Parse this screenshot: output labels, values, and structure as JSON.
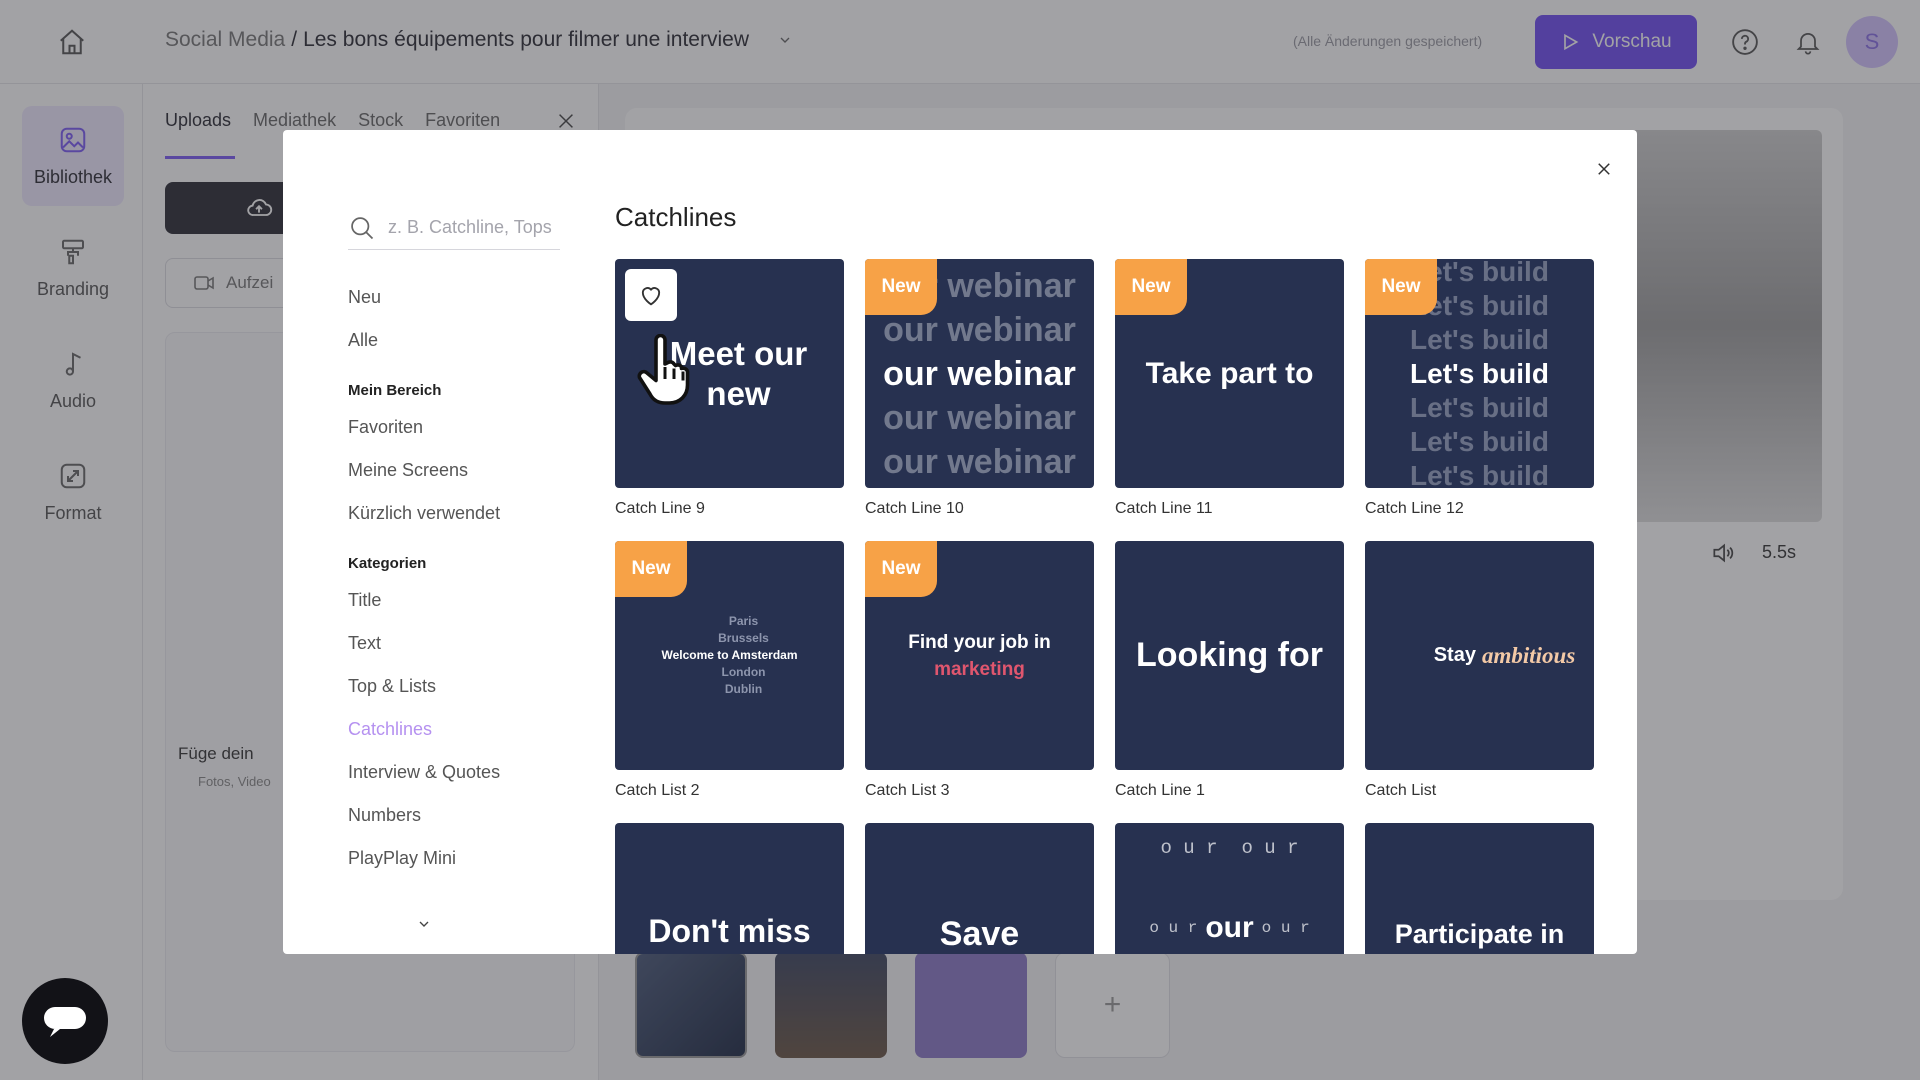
{
  "header": {
    "breadcrumb_parent": "Social Media",
    "breadcrumb_separator": " / ",
    "breadcrumb_current": "Les bons équipements pour filmer une interview",
    "save_status": "(Alle Änderungen gespeichert)",
    "preview_label": "Vorschau",
    "avatar_initial": "S"
  },
  "rail": {
    "items": [
      {
        "label": "Bibliothek",
        "icon": "image-icon"
      },
      {
        "label": "Branding",
        "icon": "paint-roller-icon"
      },
      {
        "label": "Audio",
        "icon": "music-note-icon"
      },
      {
        "label": "Format",
        "icon": "resize-icon"
      }
    ]
  },
  "library": {
    "tabs": [
      "Uploads",
      "Mediathek",
      "Stock",
      "Favoriten"
    ],
    "record_label": "Aufzei",
    "drop_title": "Füge dein",
    "drop_sub": "Fotos, Video"
  },
  "editor": {
    "duration": "5.5s",
    "timeline_add": "+"
  },
  "modal": {
    "search_placeholder": "z. B. Catchline, Tops",
    "nav_top": [
      "Neu",
      "Alle"
    ],
    "section_mine": "Mein Bereich",
    "nav_mine": [
      "Favoriten",
      "Meine Screens",
      "Kürzlich verwendet"
    ],
    "section_categories": "Kategorien",
    "nav_categories": [
      "Title",
      "Text",
      "Top & Lists",
      "Catchlines",
      "Interview & Quotes",
      "Numbers",
      "PlayPlay Mini"
    ],
    "active_category": "Catchlines",
    "section_title": "Catchlines",
    "new_badge": "New",
    "cards": [
      {
        "label": "Catch Line 9",
        "text": "Meet our new",
        "new": false
      },
      {
        "label": "Catch Line 10",
        "text": "our webinar",
        "new": true
      },
      {
        "label": "Catch Line 11",
        "text": "Take part to",
        "new": true
      },
      {
        "label": "Catch Line 12",
        "text": "Let's build",
        "new": true
      },
      {
        "label": "Catch List 2",
        "text_lines": [
          "Paris",
          "Brussels",
          "Welcome to Amsterdam",
          "London",
          "Dublin"
        ],
        "new": true
      },
      {
        "label": "Catch List 3",
        "text_lines": [
          "Find your job in",
          "marketing"
        ],
        "new": true
      },
      {
        "label": "Catch Line 1",
        "text": "Looking for",
        "new": false
      },
      {
        "label": "Catch List",
        "text_lines": [
          "Stay",
          "ambitious"
        ],
        "new": false
      },
      {
        "label": "",
        "text": "Don't miss",
        "new": false
      },
      {
        "label": "",
        "text": "Save",
        "new": false
      },
      {
        "label": "",
        "text_lines": [
          "o u r",
          "o u r",
          "our",
          "o u r",
          "o u r",
          "o u r",
          "o u r"
        ],
        "new": false
      },
      {
        "label": "",
        "text": "Participate in",
        "new": false
      }
    ]
  },
  "colors": {
    "accent": "#6f4df3",
    "card_bg": "#273150",
    "badge": "#f7a247",
    "active_nav": "#b591f0",
    "highlight_text": "#e0566e",
    "ambitious_text": "#f3c9a6"
  }
}
